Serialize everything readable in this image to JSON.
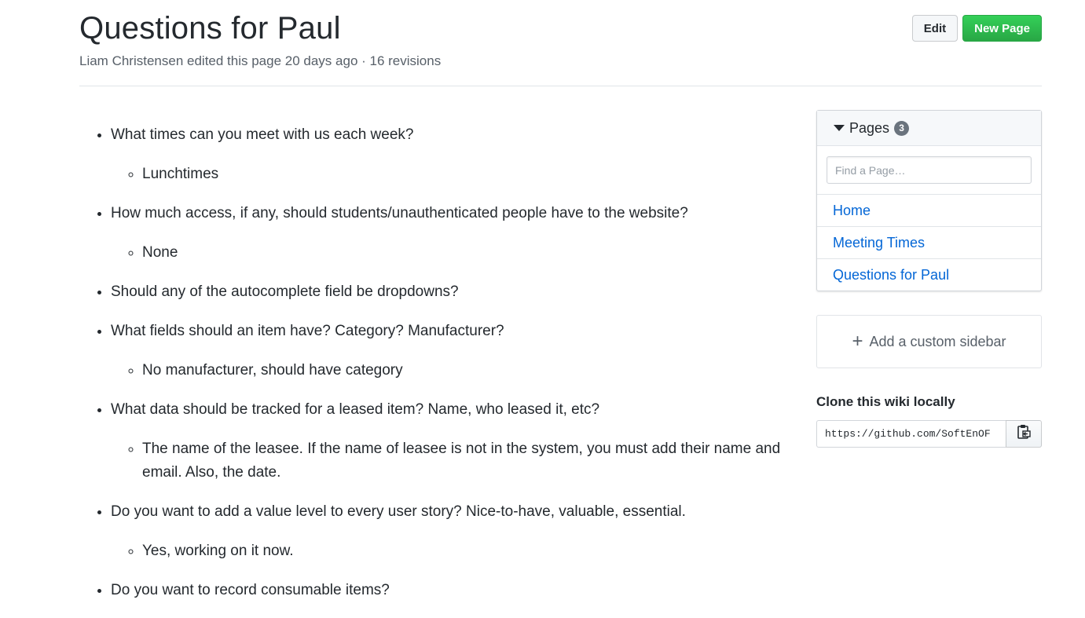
{
  "header": {
    "title": "Questions for Paul",
    "meta": "Liam Christensen edited this page 20 days ago · 16 revisions",
    "edit_label": "Edit",
    "new_page_label": "New Page"
  },
  "content": {
    "items": [
      {
        "text": "What times can you meet with us each week?",
        "sub": [
          "Lunchtimes"
        ]
      },
      {
        "text": "How much access, if any, should students/unauthenticated people have to the website?",
        "sub": [
          "None"
        ]
      },
      {
        "text": "Should any of the autocomplete field be dropdowns?",
        "sub": []
      },
      {
        "text": "What fields should an item have? Category? Manufacturer?",
        "sub": [
          "No manufacturer, should have category"
        ]
      },
      {
        "text": "What data should be tracked for a leased item? Name, who leased it, etc?",
        "sub": [
          "The name of the leasee. If the name of leasee is not in the system, you must add their name and email. Also, the date."
        ]
      },
      {
        "text": "Do you want to add a value level to every user story? Nice-to-have, valuable, essential.",
        "sub": [
          "Yes, working on it now."
        ]
      },
      {
        "text": "Do you want to record consumable items?",
        "sub": []
      }
    ]
  },
  "sidebar": {
    "pages_title": "Pages",
    "pages_count": "3",
    "filter_placeholder": "Find a Page…",
    "pages": [
      "Home",
      "Meeting Times",
      "Questions for Paul"
    ],
    "add_sidebar_label": "Add a custom sidebar",
    "clone_label": "Clone this wiki locally",
    "clone_url": "https://github.com/SoftEnOF"
  },
  "icons": {
    "pages_toggle": "triangle-down-icon",
    "add": "plus-icon",
    "copy": "clipboard-icon"
  },
  "colors": {
    "link": "#0366d6",
    "new_page_button": "#2cbe4e",
    "count_badge": "#6a737d"
  }
}
